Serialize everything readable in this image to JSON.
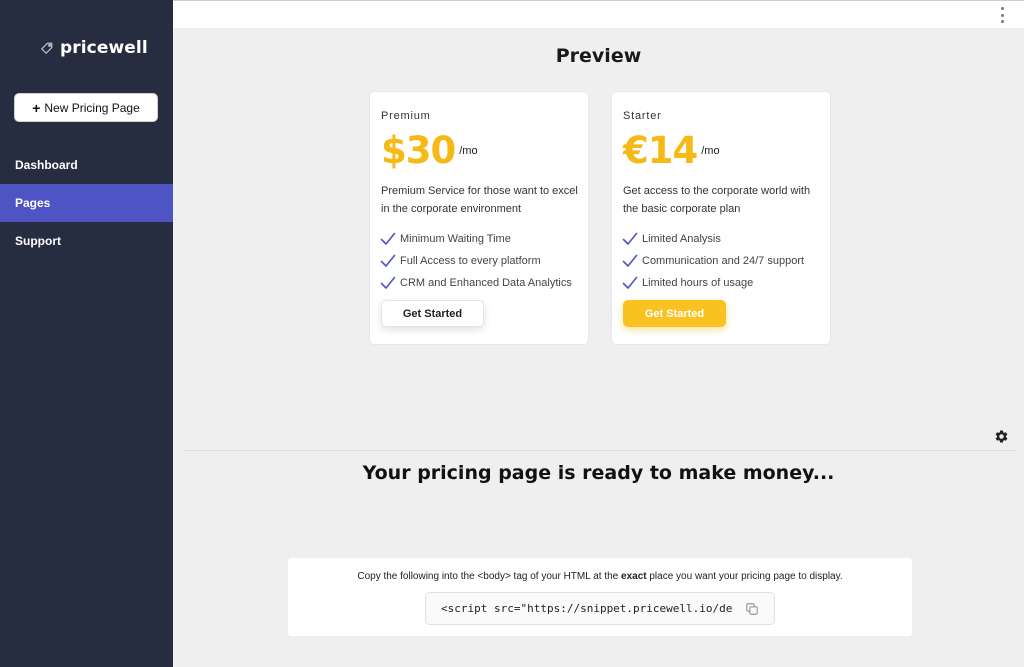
{
  "app": {
    "name": "pricewell"
  },
  "sidebar": {
    "new_button_label": "New Pricing Page",
    "items": [
      {
        "label": "Dashboard",
        "active": false
      },
      {
        "label": "Pages",
        "active": true
      },
      {
        "label": "Support",
        "active": false
      }
    ]
  },
  "main": {
    "preview_title": "Preview",
    "ready_title": "Your pricing page is ready to make money...",
    "snippet": {
      "instr_before": "Copy the following into the <body> tag of your HTML at the ",
      "instr_bold": "exact",
      "instr_after": " place you want your pricing page to display.",
      "code": "<script src=\"https://snippet.pricewell.io/de"
    }
  },
  "plans": [
    {
      "name": "Premium",
      "price": "$30",
      "period": "/mo",
      "description": "Premium Service for those want to excel in the corporate environment",
      "features": [
        "Minimum Waiting Time",
        "Full Access to every platform",
        "CRM and Enhanced Data Analytics"
      ],
      "cta": "Get Started"
    },
    {
      "name": "Starter",
      "price": "€14",
      "period": "/mo",
      "description": "Get access to the corporate world with the basic corporate plan",
      "features": [
        "Limited Analysis",
        "Communication and 24/7 support",
        "Limited hours of usage"
      ],
      "cta": "Get Started"
    }
  ],
  "colors": {
    "sidebar_bg": "#262d40",
    "active_nav": "#4f54c5",
    "price_accent": "#f6b916",
    "check": "#4f54c5",
    "cta_yellow": "#f9c221"
  },
  "icons": {
    "logo": "price-tag-icon",
    "new_button": "plus-icon",
    "feature": "check-icon",
    "menu": "kebab-menu-icon",
    "settings": "gear-icon",
    "copy": "copy-icon"
  }
}
